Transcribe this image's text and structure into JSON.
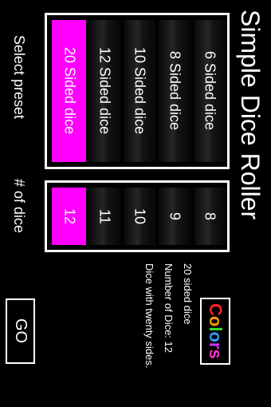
{
  "title": "Simple Dice Roller",
  "colors_button": {
    "letters": [
      "C",
      "o",
      "l",
      "o",
      "r",
      "s"
    ],
    "colors": [
      "#ff2020",
      "#ff9900",
      "#33dd33",
      "#3399ff",
      "#cc33ff",
      "#ff33cc"
    ]
  },
  "info": {
    "name": "20 sided dice",
    "count": "Number of Dice: 12",
    "desc": "Dice with twenty sides."
  },
  "preset_wheel": {
    "items": [
      "6 Sided dice",
      "8 Sided dice",
      "10 Sided dice",
      "12 Sided dice",
      "20 Sided dice"
    ],
    "selected_index": 4
  },
  "count_wheel": {
    "items": [
      "8",
      "9",
      "10",
      "11",
      "12"
    ],
    "selected_index": 4
  },
  "labels": {
    "select_preset": "Select preset",
    "num_dice": "# of dice"
  },
  "go_button": "GO",
  "accent": "#ff00ff"
}
